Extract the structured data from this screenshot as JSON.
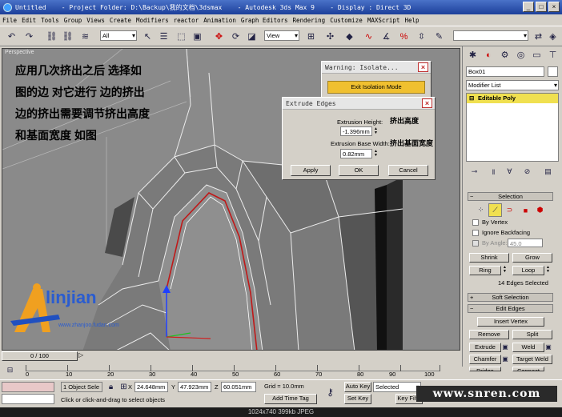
{
  "window": {
    "title": "Untitled    - Project Folder: D:\\Backup\\我的文档\\3dsmax    - Autodesk 3ds Max 9    - Display : Direct 3D",
    "min": "_",
    "max": "□",
    "close": "×"
  },
  "menu": [
    "File",
    "Edit",
    "Tools",
    "Group",
    "Views",
    "Create",
    "Modifiers",
    "reactor",
    "Animation",
    "Graph Editors",
    "Rendering",
    "Customize",
    "MAXScript",
    "Help"
  ],
  "toolbar": {
    "selection_filter": "All",
    "ref_coord": "View"
  },
  "viewport": {
    "label": "Perspective",
    "annotation": "应用几次挤出之后 选择如图的边 对它进行 边的挤出 边的挤出需要调节挤出高度和基面宽度 如图"
  },
  "watermark": {
    "brand": "linjian",
    "sub": "www.zhanjoo.fudan.com"
  },
  "isolate_dialog": {
    "title": "Warning: Isolate...",
    "button": "Exit Isolation Mode"
  },
  "extrude_dialog": {
    "title": "Extrude Edges",
    "height_label": "Extrusion Height:",
    "height_cn": "挤出高度",
    "height_value": "-1.396mm",
    "width_label": "Extrusion Base Width:",
    "width_cn": "挤出基面宽度",
    "width_value": "0.82mm",
    "apply": "Apply",
    "ok": "OK",
    "cancel": "Cancel"
  },
  "panel": {
    "object_name": "Box01",
    "modifier_list": "Modifier List",
    "stack_item": "Editable Poly",
    "selection_title": "Selection",
    "by_vertex": "By Vertex",
    "ignore_backfacing": "Ignore Backfacing",
    "by_angle": "By Angle:",
    "angle_value": "45.0",
    "shrink": "Shrink",
    "grow": "Grow",
    "ring": "Ring",
    "loop": "Loop",
    "selected_info": "14 Edges Selected",
    "soft_selection": "Soft Selection",
    "edit_edges": "Edit Edges",
    "insert_vertex": "Insert Vertex",
    "remove": "Remove",
    "split": "Split",
    "extrude": "Extrude",
    "weld": "Weld",
    "chamfer": "Chamfer",
    "target_weld": "Target Weld",
    "bridge": "Bridge",
    "connect": "Connect"
  },
  "timeline": {
    "frame": "0 / 100",
    "ticks": [
      "0",
      "10",
      "20",
      "30",
      "40",
      "50",
      "60",
      "70",
      "80",
      "90",
      "100"
    ]
  },
  "status": {
    "selection": "1 Object Sele",
    "prompt": "Click or click-and-drag to select objects",
    "x": "24.648mm",
    "y": "47.923mm",
    "z": "60.051mm",
    "grid": "Grid = 10.0mm",
    "add_time_tag": "Add Time Tag",
    "auto_key": "Auto Key",
    "set_key": "Set Key",
    "selected": "Selected",
    "key_filters": "Key Filte"
  },
  "site_watermark": "www.snren.com",
  "image_info": "1024x740  399kb  JPEG"
}
